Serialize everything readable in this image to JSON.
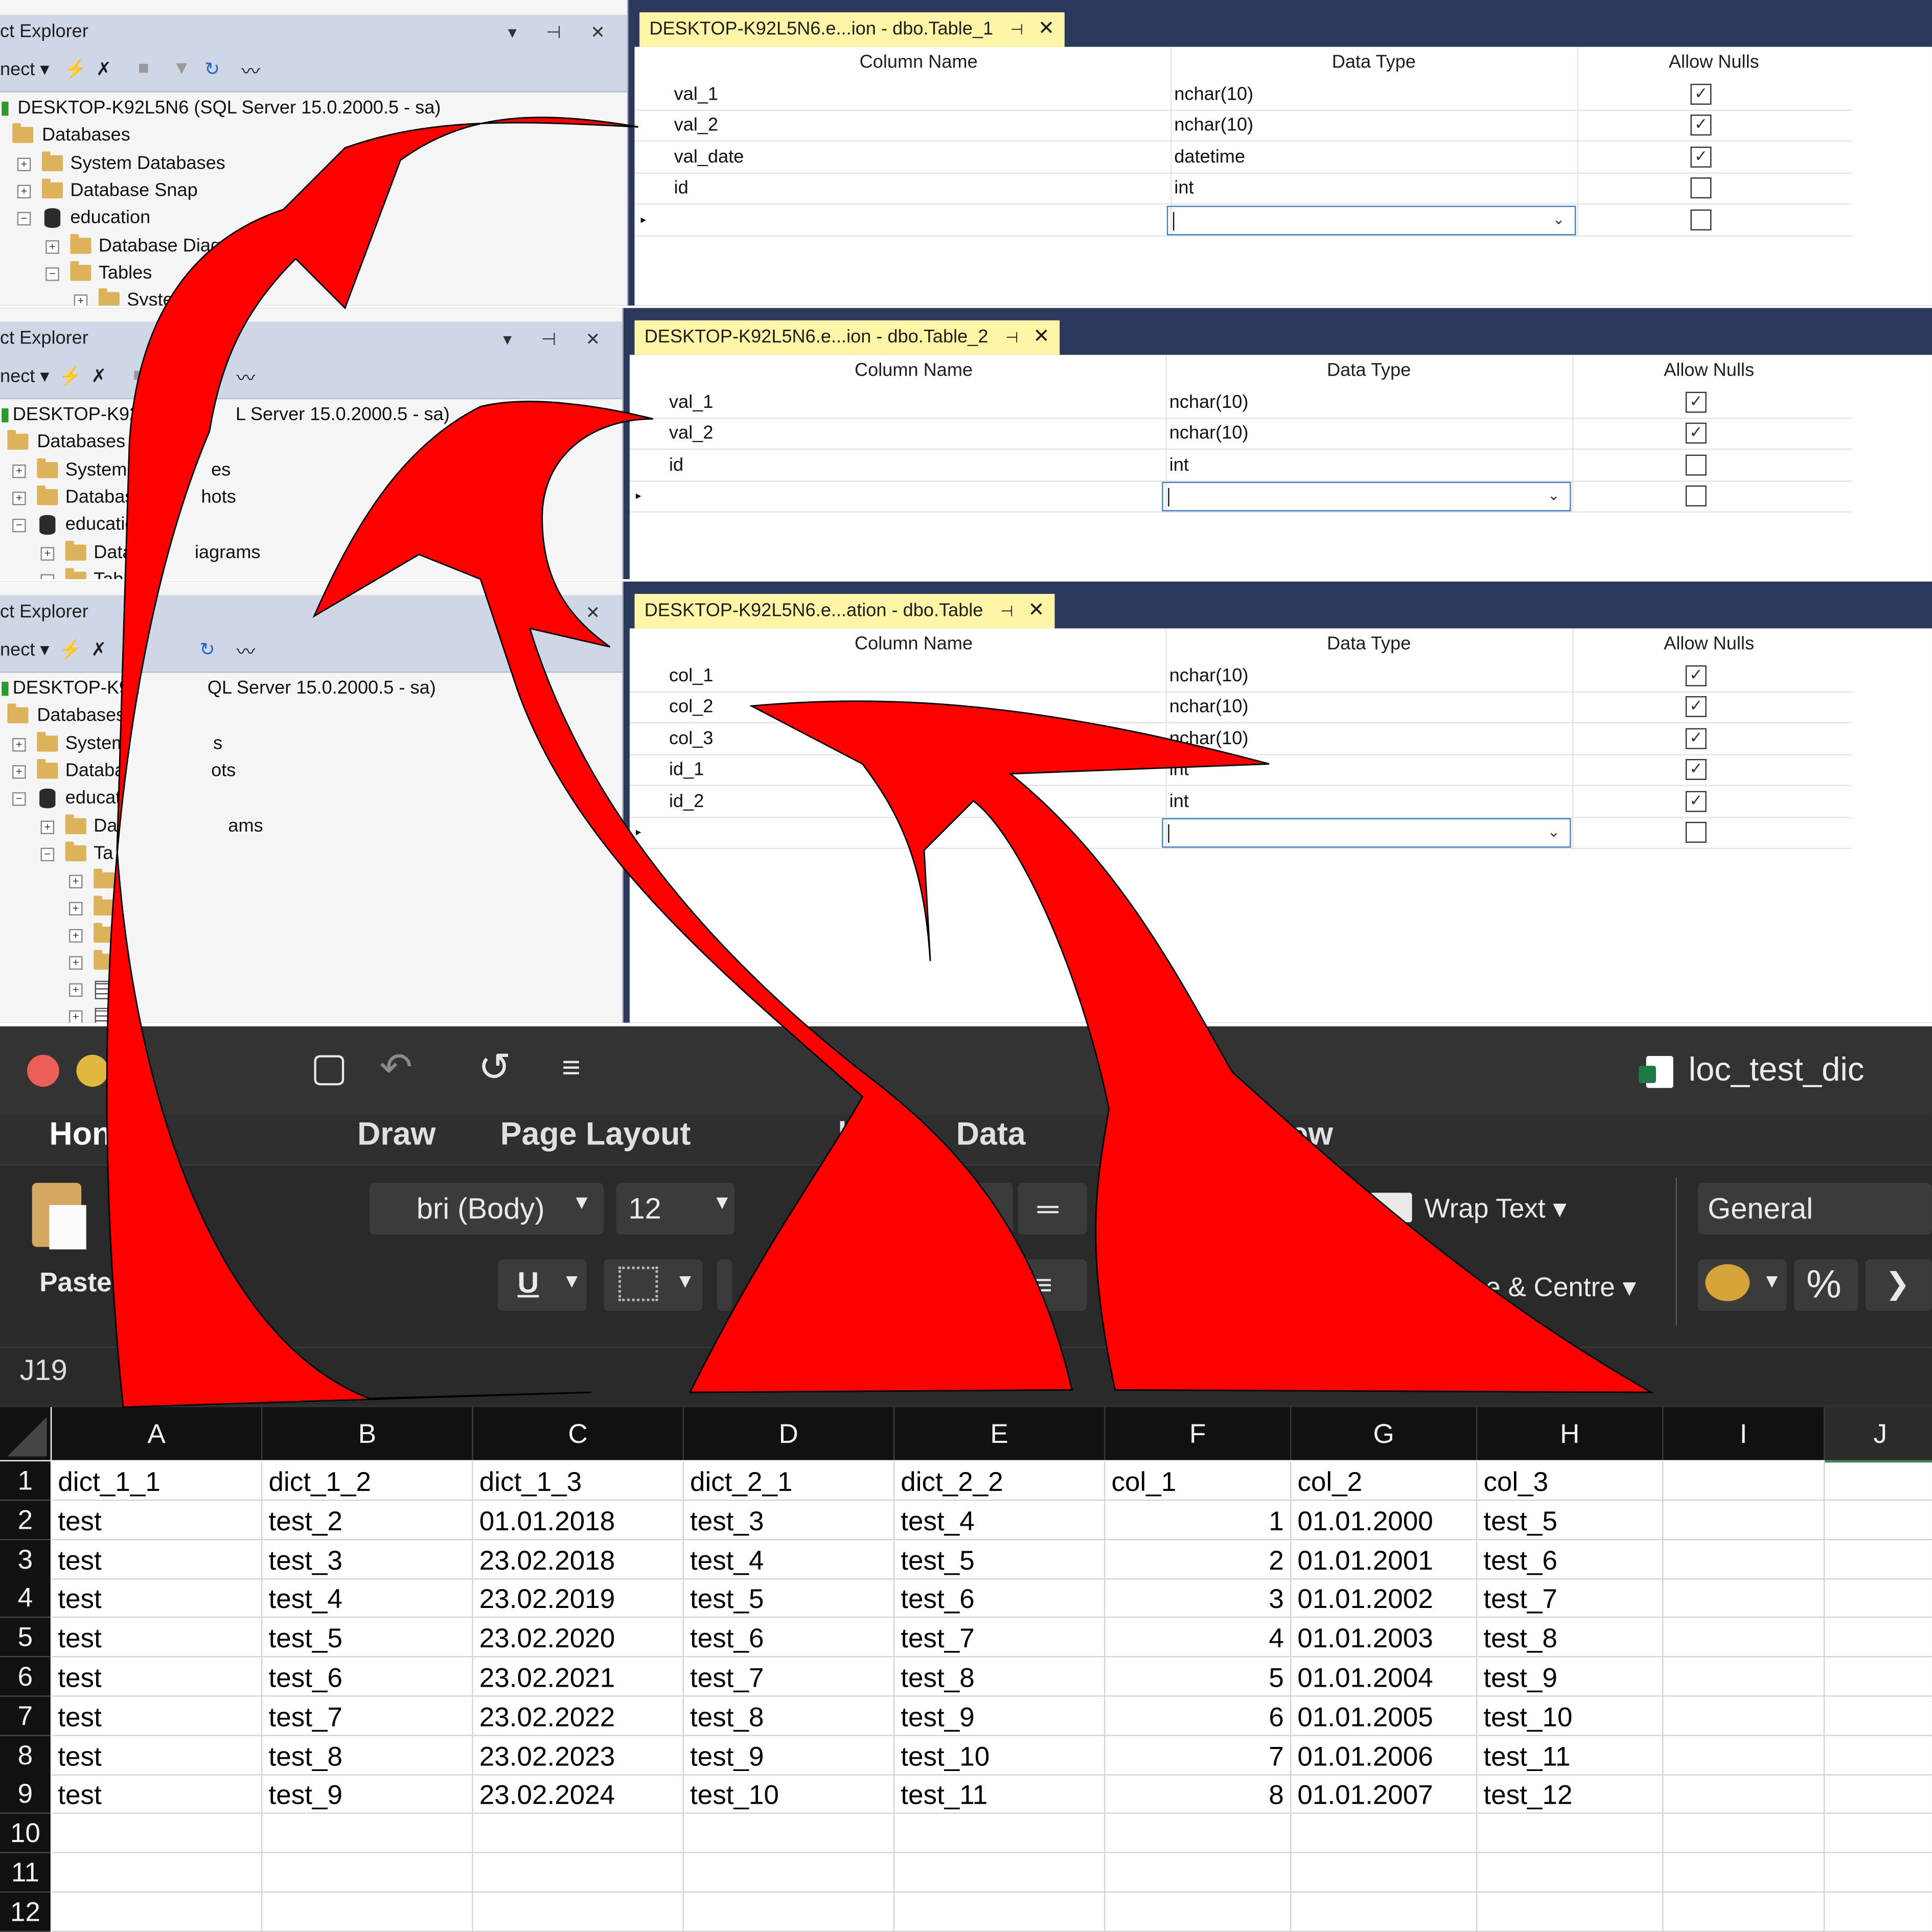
{
  "object_explorer": {
    "title": "ct Explorer",
    "connect_label": "nect",
    "server_1": "DESKTOP-K92L5N6 (SQL Server 15.0.2000.5 - sa)",
    "server_2": "DESKTOP-K92L5N6",
    "server_2b": "L Server 15.0.2000.5 - sa)",
    "server_3": "DESKTOP-K92",
    "server_3b": "QL Server 15.0.2000.5 - sa)",
    "databases": "Databases",
    "system_databases": "System Databases",
    "database_snapshots": "Database Snap",
    "education": "education",
    "database_diagrams": "Database Diagram",
    "tables": "Tables",
    "system_tables": "System Ta",
    "p2_system": "System Da",
    "p2_system_b": "es",
    "p2_snap": "Database",
    "p2_snap_b": "hots",
    "p2_edu": "education",
    "p2_diag": "Datab",
    "p2_diag_b": "iagrams",
    "p2_tables": "Table",
    "p3_system": "System",
    "p3_system_b": "s",
    "p3_snap": "Databa",
    "p3_snap_b": "ots",
    "p3_edu": "educat",
    "p3_diag": "Da",
    "p3_diag_b": "ams",
    "p3_tables": "Ta"
  },
  "designers": [
    {
      "tab": "DESKTOP-K92L5N6.e...ion - dbo.Table_1",
      "headers": [
        "Column Name",
        "Data Type",
        "Allow Nulls"
      ],
      "rows": [
        {
          "name": "val_1",
          "type": "nchar(10)",
          "nulls": "☑"
        },
        {
          "name": "val_2",
          "type": "nchar(10)",
          "nulls": "☑"
        },
        {
          "name": "val_date",
          "type": "datetime",
          "nulls": "☑"
        },
        {
          "name": "id",
          "type": "int",
          "nulls": ""
        }
      ]
    },
    {
      "tab": "DESKTOP-K92L5N6.e...ion - dbo.Table_2",
      "headers": [
        "Column Name",
        "Data Type",
        "Allow Nulls"
      ],
      "rows": [
        {
          "name": "val_1",
          "type": "nchar(10)",
          "nulls": "☑"
        },
        {
          "name": "val_2",
          "type": "nchar(10)",
          "nulls": "☑"
        },
        {
          "name": "id",
          "type": "int",
          "nulls": ""
        }
      ]
    },
    {
      "tab": "DESKTOP-K92L5N6.e...ation - dbo.Table",
      "headers": [
        "Column Name",
        "Data Type",
        "Allow Nulls"
      ],
      "rows": [
        {
          "name": "col_1",
          "type": "nchar(10)",
          "nulls": "☑"
        },
        {
          "name": "col_2",
          "type": "nchar(10)",
          "nulls": "☑"
        },
        {
          "name": "col_3",
          "type": "nchar(10)",
          "nulls": "☑"
        },
        {
          "name": "id_1",
          "type": "int",
          "nulls": "☑"
        },
        {
          "name": "id_2",
          "type": "int",
          "nulls": "☑"
        }
      ]
    }
  ],
  "excel": {
    "filename": "loc_test_dic",
    "tabs": [
      "Hon",
      "Draw",
      "Page Layout",
      "las",
      "Data",
      "iew"
    ],
    "paste": "Paste",
    "font": "bri (Body)",
    "font_size": "12",
    "wrap_text": "Wrap Text",
    "merge": "rge & Centre",
    "number_format": "General",
    "underline": "U",
    "percent": "%",
    "cell_ref": "J19",
    "columns": [
      "A",
      "B",
      "C",
      "D",
      "E",
      "F",
      "G",
      "H",
      "I",
      "J"
    ],
    "row_numbers": [
      "1",
      "2",
      "3",
      "4",
      "5",
      "6",
      "7",
      "8",
      "9",
      "10",
      "11",
      "12"
    ],
    "rows": [
      [
        "dict_1_1",
        "dict_1_2",
        "dict_1_3",
        "dict_2_1",
        "dict_2_2",
        "col_1",
        "col_2",
        "col_3"
      ],
      [
        "test",
        "test_2",
        "01.01.2018",
        "test_3",
        "test_4",
        "1",
        "01.01.2000",
        "test_5"
      ],
      [
        "test",
        "test_3",
        "23.02.2018",
        "test_4",
        "test_5",
        "2",
        "01.01.2001",
        "test_6"
      ],
      [
        "test",
        "test_4",
        "23.02.2019",
        "test_5",
        "test_6",
        "3",
        "01.01.2002",
        "test_7"
      ],
      [
        "test",
        "test_5",
        "23.02.2020",
        "test_6",
        "test_7",
        "4",
        "01.01.2003",
        "test_8"
      ],
      [
        "test",
        "test_6",
        "23.02.2021",
        "test_7",
        "test_8",
        "5",
        "01.01.2004",
        "test_9"
      ],
      [
        "test",
        "test_7",
        "23.02.2022",
        "test_8",
        "test_9",
        "6",
        "01.01.2005",
        "test_10"
      ],
      [
        "test",
        "test_8",
        "23.02.2023",
        "test_9",
        "test_10",
        "7",
        "01.01.2006",
        "test_11"
      ],
      [
        "test",
        "test_9",
        "23.02.2024",
        "test_10",
        "test_11",
        "8",
        "01.01.2007",
        "test_12"
      ]
    ]
  },
  "colors": {
    "arrow": "#ff0000",
    "tab_active": "#fff5a6",
    "ssms_frame": "#2b3a5c",
    "excel_dark": "#2f2f2f"
  }
}
